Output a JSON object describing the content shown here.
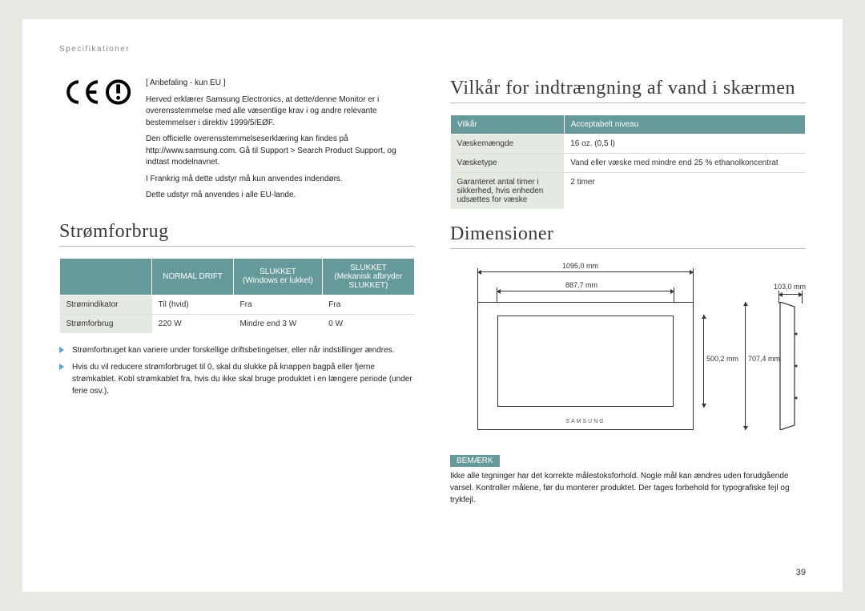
{
  "breadcrumb": "Specifikationer",
  "ce": {
    "title": "[ Anbefaling - kun EU ]",
    "p1": "Herved erklærer Samsung Electronics, at dette/denne Monitor er i overensstemmelse med alle væsentlige krav i og andre relevante bestemmelser i direktiv 1999/5/EØF.",
    "p2": "Den officielle overensstemmelseserklæring kan findes på http://www.samsung.com. Gå til Support > Search Product Support, og indtast modelnavnet.",
    "p3": "I Frankrig må dette udstyr må kun anvendes indendørs.",
    "p4": "Dette udstyr må anvendes i alle EU-lande."
  },
  "power": {
    "heading": "Strømforbrug",
    "th_blank": "",
    "th1": "NORMAL DRIFT",
    "th2": "SLUKKET",
    "th2_sub": "(Windows er lukket)",
    "th3": "SLUKKET",
    "th3_sub": "(Mekanisk afbryder SLUKKET)",
    "rows": [
      {
        "label": "Strømindikator",
        "c1": "Til (hvid)",
        "c2": "Fra",
        "c3": "Fra"
      },
      {
        "label": "Strømforbrug",
        "c1": "220 W",
        "c2": "Mindre end 3 W",
        "c3": "0 W"
      }
    ],
    "bullets": [
      "Strømforbruget kan variere under forskellige driftsbetingelser, eller når indstillinger ændres.",
      "Hvis du vil reducere strømforbruget til 0, skal du slukke på knappen bagpå eller fjerne strømkablet. Kobl strømkablet fra, hvis du ikke skal bruge produktet i en længere periode (under ferie osv.)."
    ]
  },
  "water": {
    "heading": "Vilkår for indtrængning af vand i skærmen",
    "th1": "Vilkår",
    "th2": "Acceptabelt niveau",
    "rows": [
      {
        "label": "Væskemængde",
        "val": "16 oz. (0,5 l)"
      },
      {
        "label": "Væsketype",
        "val": "Vand eller væske med mindre end 25 % ethanolkoncentrat"
      },
      {
        "label": "Garanteret antal timer i sikkerhed, hvis enheden udsættes for væske",
        "val": "2 timer"
      }
    ]
  },
  "dims": {
    "heading": "Dimensioner",
    "w_outer": "1095,0 mm",
    "w_inner": "887,7 mm",
    "h_inner": "500,2 mm",
    "h_outer": "707,4 mm",
    "depth": "103,0 mm",
    "brand": "SAMSUNG",
    "note_tag": "BEMÆRK",
    "note": "Ikke alle tegninger har det korrekte målestoksforhold. Nogle mål kan ændres uden forudgående varsel. Kontroller målene, før du monterer produktet. Der tages forbehold for typografiske fejl og trykfejl."
  },
  "page_number": "39"
}
